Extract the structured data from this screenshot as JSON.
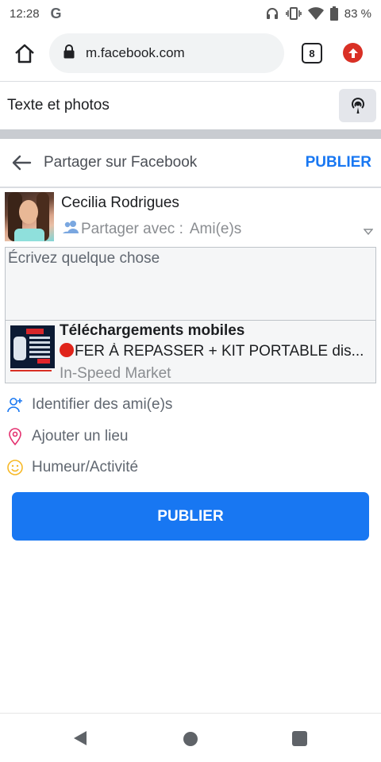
{
  "status_bar": {
    "time": "12:28",
    "google_icon": "G",
    "battery": "83 %",
    "icons": [
      "headphones-icon",
      "vibrate-icon",
      "wifi-icon",
      "battery-icon"
    ]
  },
  "browser": {
    "url": "m.facebook.com",
    "tab_count": "8",
    "icons": [
      "home-icon",
      "lock-icon",
      "tabs-icon",
      "update-icon"
    ]
  },
  "composer_bar": {
    "label": "Texte et photos",
    "icon": "live-broadcast-icon"
  },
  "share_header": {
    "title": "Partager sur Facebook",
    "publish_label": "PUBLIER",
    "back_icon": "back-arrow-icon"
  },
  "user": {
    "name": "Cecilia Rodrigues",
    "audience_prefix": "Partager avec :",
    "audience_value": "Ami(e)s"
  },
  "compose": {
    "placeholder": "Écrivez quelque chose"
  },
  "link_preview": {
    "title": "Téléchargements mobiles",
    "description": "FER À REPASSER + KIT PORTABLE dis...",
    "source": "In-Speed Market"
  },
  "options": [
    {
      "label": "Identifier des ami(e)s",
      "icon": "tag-friends-icon",
      "color": "#1877f2"
    },
    {
      "label": "Ajouter un lieu",
      "icon": "location-pin-icon",
      "color": "#e4316f"
    },
    {
      "label": "Humeur/Activité",
      "icon": "smiley-icon",
      "color": "#f7b928"
    }
  ],
  "publish_button": {
    "label": "PUBLIER"
  },
  "colors": {
    "accent": "#1877f2",
    "update_badge": "#d93025"
  }
}
